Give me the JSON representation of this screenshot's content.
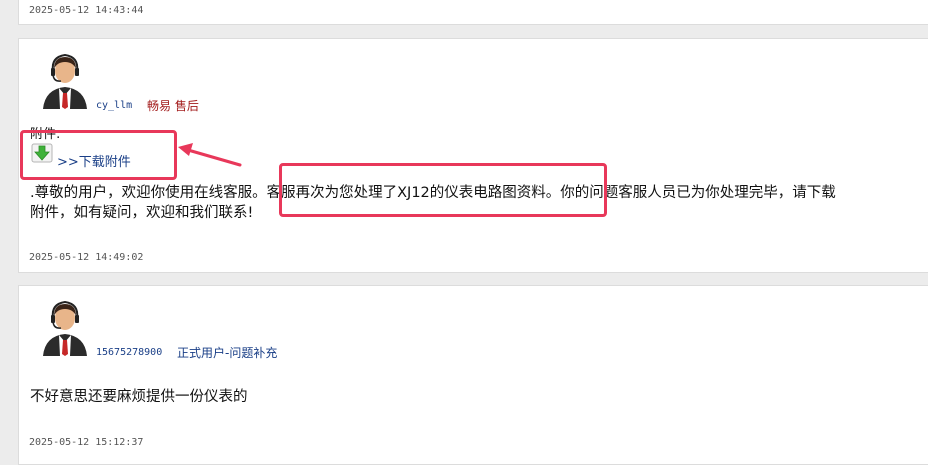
{
  "top_post": {
    "timestamp": "2025-05-12 14:43:44"
  },
  "post1": {
    "username": "cy_llm",
    "role": "畅易 售后",
    "attachment_label": "附件:",
    "download_link": ">>下载附件",
    "message_line1": ".尊敬的用户，欢迎你使用在线客服。客服再次为您处理了XJ12的仪表电路图资料。你的问题客服人员已为你处理完毕，请下载",
    "message_line2": "附件，如有疑问，欢迎和我们联系!",
    "timestamp": "2025-05-12 14:49:02"
  },
  "post2": {
    "username": "15675278900",
    "role": "正式用户-问题补充",
    "message": "不好意思还要麻烦提供一份仪表的",
    "timestamp": "2025-05-12 15:12:37"
  },
  "colors": {
    "role_staff": "#a31c1c",
    "role_user": "#1a3f87",
    "highlight": "#e8385a",
    "link": "#1a3f87"
  },
  "icons": [
    "avatar-agent-icon",
    "download-arrow-icon",
    "callout-arrow-icon"
  ]
}
